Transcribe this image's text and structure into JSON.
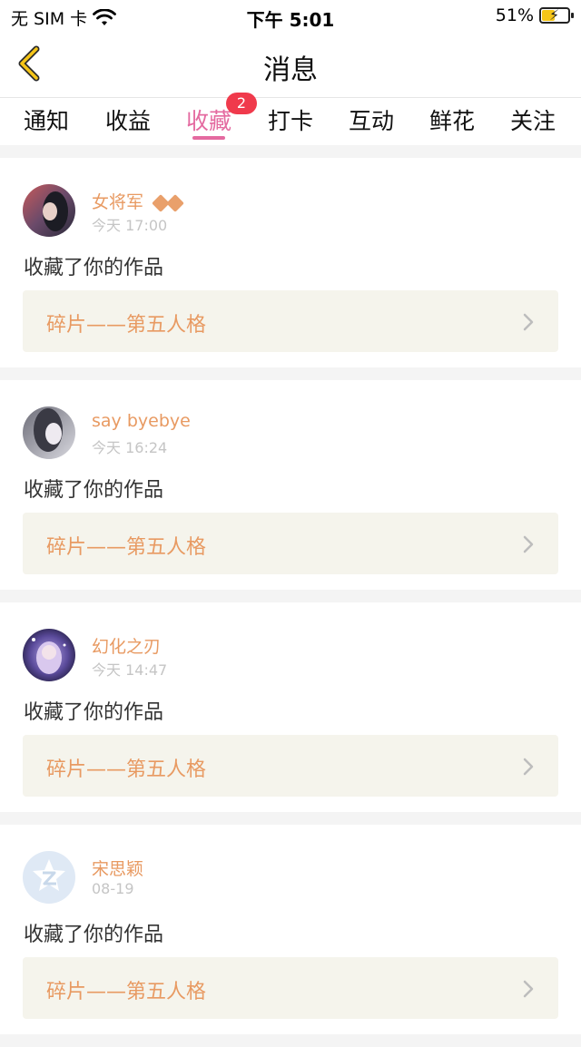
{
  "status_bar": {
    "carrier": "无 SIM 卡",
    "time": "下午 5:01",
    "battery": "51%",
    "battery_level": 0.51,
    "icons": [
      "wifi-icon",
      "battery-charging-icon"
    ]
  },
  "header": {
    "title": "消息",
    "back_icon": "chevron-left-icon",
    "accent_color": "#f5c518"
  },
  "tabs": {
    "items": [
      {
        "label": "通知"
      },
      {
        "label": "收益"
      },
      {
        "label": "收藏",
        "active": true,
        "badge": "2"
      },
      {
        "label": "打卡"
      },
      {
        "label": "互动"
      },
      {
        "label": "鲜花"
      },
      {
        "label": "关注"
      }
    ],
    "active_color": "#e46aa0",
    "badge_color": "#f03a4c"
  },
  "feed": {
    "items": [
      {
        "user": "女将军",
        "time": "今天 17:00",
        "message": "收藏了你的作品",
        "work": "碎片——第五人格",
        "vip": true
      },
      {
        "user": "say byebye",
        "time": "今天 16:24",
        "message": "收藏了你的作品",
        "work": "碎片——第五人格",
        "vip": false
      },
      {
        "user": "幻化之刃",
        "time": "今天 14:47",
        "message": "收藏了你的作品",
        "work": "碎片——第五人格",
        "vip": false
      },
      {
        "user": "宋思颖",
        "time": "08-19",
        "message": "收藏了你的作品",
        "work": "碎片——第五人格",
        "vip": false
      }
    ],
    "name_color": "#e89a62"
  }
}
